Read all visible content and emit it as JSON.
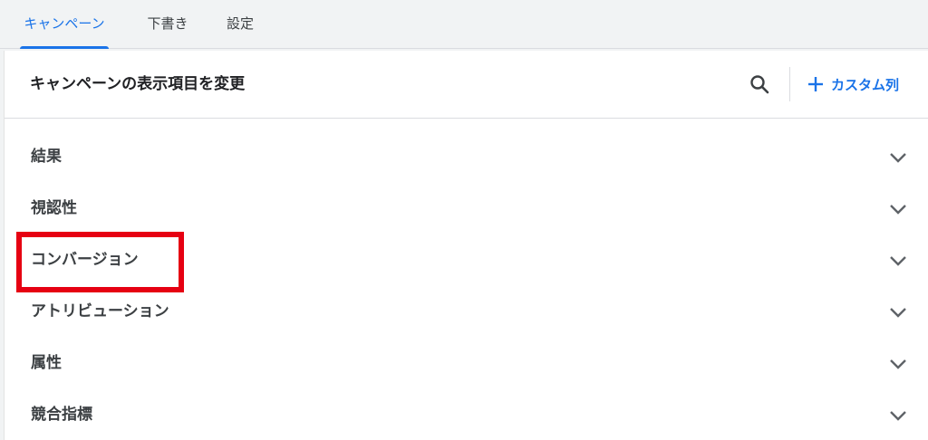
{
  "tabs": [
    {
      "label": "キャンペーン",
      "active": true
    },
    {
      "label": "下書き",
      "active": false
    },
    {
      "label": "設定",
      "active": false
    }
  ],
  "panel": {
    "title": "キャンペーンの表示項目を変更",
    "search_icon": "search-icon",
    "custom_column_label": "カスタム列",
    "custom_column_icon": "plus-icon"
  },
  "rows": [
    {
      "label": "結果"
    },
    {
      "label": "視認性"
    },
    {
      "label": "コンバージョン"
    },
    {
      "label": "アトリビューション"
    },
    {
      "label": "属性"
    },
    {
      "label": "競合指標"
    }
  ],
  "colors": {
    "accent": "#1a73e8",
    "highlight": "#e60012",
    "text": "#3c4043"
  }
}
